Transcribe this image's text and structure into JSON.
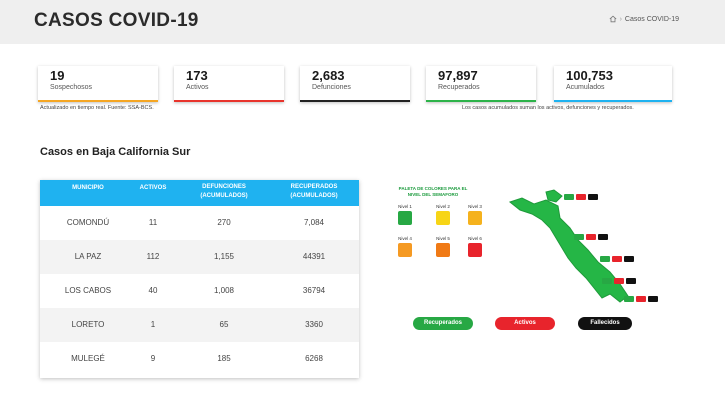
{
  "header": {
    "title": "CASOS COVID-19",
    "breadcrumb_home_icon": "home-icon",
    "breadcrumb_current": "Casos COVID-19"
  },
  "summary": [
    {
      "value": "19",
      "label": "Sospechosos",
      "color": "#f5a623"
    },
    {
      "value": "173",
      "label": "Activos",
      "color": "#e8342c"
    },
    {
      "value": "2,683",
      "label": "Defunciones",
      "color": "#222222"
    },
    {
      "value": "97,897",
      "label": "Recuperados",
      "color": "#2db34a"
    },
    {
      "value": "100,753",
      "label": "Acumulados",
      "color": "#1fb2f0"
    }
  ],
  "notes": {
    "left": "Actualizado en tiempo real. Fuente: SSA-BCS.",
    "right": "Los casos acumulados suman los activos, defunciones y recuperados."
  },
  "section_title": "Casos en Baja California Sur",
  "table": {
    "headers": [
      "MUNICIPIO",
      "ACTIVOS",
      "DEFUNCIONES (ACUMULADOS)",
      "RECUPERADOS (ACUMULADOS)"
    ],
    "rows": [
      [
        "COMONDÚ",
        "11",
        "270",
        "7,084"
      ],
      [
        "LA PAZ",
        "112",
        "1,155",
        "44391"
      ],
      [
        "LOS CABOS",
        "40",
        "1,008",
        "36794"
      ],
      [
        "LORETO",
        "1",
        "65",
        "3360"
      ],
      [
        "MULEGÉ",
        "9",
        "185",
        "6268"
      ]
    ]
  },
  "palette": {
    "title": "PALETA DE COLORES PARA EL NIVEL DEL SEMAFORO",
    "levels": [
      {
        "label": "Nivel 1",
        "color": "#27a844"
      },
      {
        "label": "Nivel 2",
        "color": "#f7d516"
      },
      {
        "label": "Nivel 3",
        "color": "#f5b21d"
      },
      {
        "label": "Nivel 4",
        "color": "#f59a23"
      },
      {
        "label": "Nivel 5",
        "color": "#f07a16"
      },
      {
        "label": "Nivel 6",
        "color": "#e8242c"
      }
    ]
  },
  "map": {
    "color": "#25b646"
  },
  "legend": [
    {
      "label": "Recuperados",
      "color": "#27a844"
    },
    {
      "label": "Activos",
      "color": "#e8242c"
    },
    {
      "label": "Fallecidos",
      "color": "#111111"
    }
  ]
}
